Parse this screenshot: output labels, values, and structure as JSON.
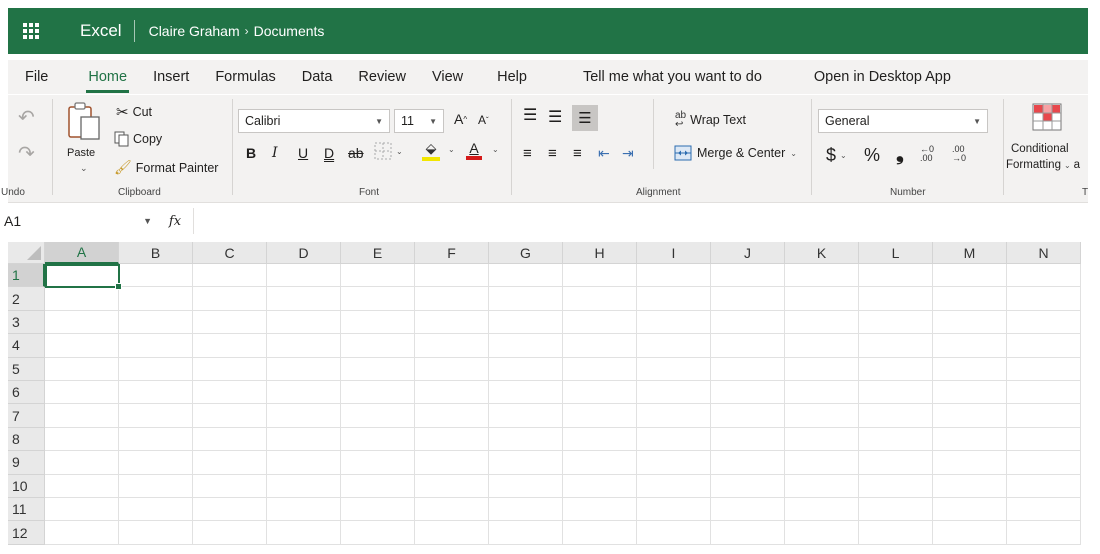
{
  "titlebar": {
    "app_name": "Excel",
    "breadcrumb_owner": "Claire Graham",
    "breadcrumb_sep": "›",
    "breadcrumb_folder": "Documents",
    "color": "#217346"
  },
  "menu": {
    "file": "File",
    "home": "Home",
    "insert": "Insert",
    "formulas": "Formulas",
    "data": "Data",
    "review": "Review",
    "view": "View",
    "help": "Help",
    "tell_me": "Tell me what you want to do",
    "open_desktop": "Open in Desktop App"
  },
  "ribbon": {
    "undo_group": "Undo",
    "clipboard_group": "Clipboard",
    "font_group": "Font",
    "alignment_group": "Alignment",
    "number_group": "Number",
    "styles_group_partial": "T",
    "paste": "Paste",
    "cut": "Cut",
    "copy": "Copy",
    "format_painter": "Format Painter",
    "font_name": "Calibri",
    "font_size": "11",
    "grow_font": "A",
    "shrink_font": "A",
    "bold": "B",
    "italic": "I",
    "underline": "U",
    "double_underline": "D",
    "strike": "ab",
    "font_color_glyph": "A",
    "wrap_text": "Wrap Text",
    "merge_center": "Merge & Center",
    "number_format": "General",
    "currency": "$",
    "percent": "%",
    "comma": "❟",
    "conditional_line1": "Conditional",
    "conditional_line2": "Formatting",
    "conditional_partial": "a"
  },
  "formula_bar": {
    "name_box": "A1",
    "fx": "fx",
    "formula": ""
  },
  "sheet": {
    "columns": [
      "A",
      "B",
      "C",
      "D",
      "E",
      "F",
      "G",
      "H",
      "I",
      "J",
      "K",
      "L",
      "M",
      "N"
    ],
    "rows": [
      "1",
      "2",
      "3",
      "4",
      "5",
      "6",
      "7",
      "8",
      "9",
      "10",
      "11",
      "12"
    ],
    "active_cell": "A1",
    "accent": "#217346"
  }
}
